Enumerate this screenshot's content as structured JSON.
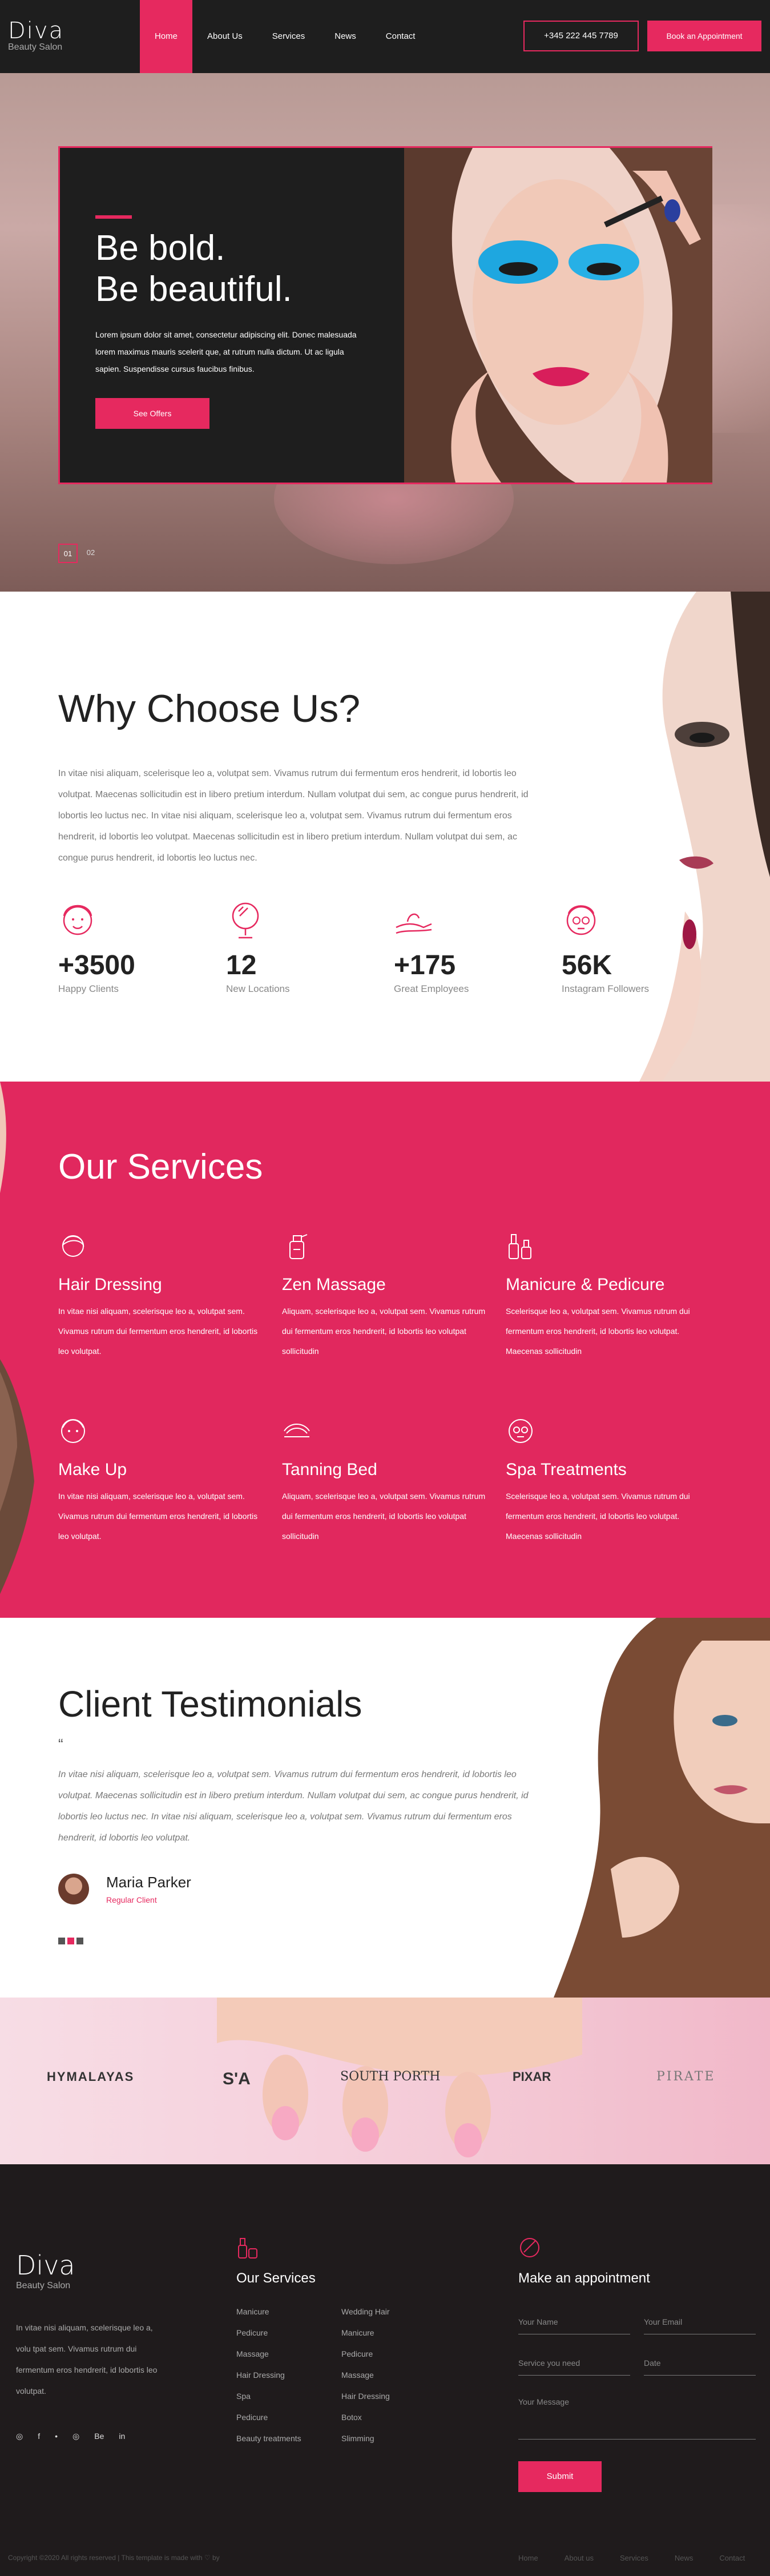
{
  "colors": {
    "accent": "#e6295f",
    "dark": "#1e1e1e"
  },
  "header": {
    "logo_name": "Diva",
    "logo_sub": "Beauty Salon",
    "nav": [
      "Home",
      "About Us",
      "Services",
      "News",
      "Contact"
    ],
    "phone": "+345 222 445 7789",
    "appointment": "Book an Appointment"
  },
  "hero": {
    "title_line1": "Be bold.",
    "title_line2": "Be beautiful.",
    "text": "Lorem ipsum dolor sit amet, consectetur adipiscing elit. Donec malesuada lorem maximus mauris scelerit que, at rutrum nulla dictum. Ut ac ligula sapien. Suspendisse cursus faucibus finibus.",
    "button": "See Offers",
    "pager": [
      "01",
      "02"
    ]
  },
  "why": {
    "title": "Why Choose Us?",
    "text": "In vitae nisi aliquam, scelerisque leo a, volutpat sem. Vivamus rutrum dui fermentum eros hendrerit, id lobortis leo volutpat. Maecenas sollicitudin est in libero pretium interdum. Nullam volutpat dui sem, ac congue purus hendrerit, id lobortis leo luctus nec. In vitae nisi aliquam, scelerisque leo a, volutpat sem. Vivamus rutrum dui fermentum eros hendrerit, id lobortis leo volutpat. Maecenas sollicitudin est in libero pretium interdum. Nullam volutpat dui sem, ac congue purus hendrerit, id lobortis leo luctus nec.",
    "stats": [
      {
        "num": "+3500",
        "label": "Happy Clients",
        "icon": "face-icon"
      },
      {
        "num": "12",
        "label": "New Locations",
        "icon": "mirror-icon"
      },
      {
        "num": "+175",
        "label": "Great Employees",
        "icon": "cream-hand-icon"
      },
      {
        "num": "56K",
        "label": "Instagram Followers",
        "icon": "face-mask-icon"
      }
    ]
  },
  "services": {
    "title": "Our Services",
    "items": [
      {
        "title": "Hair Dressing",
        "text": "In vitae nisi aliquam, scelerisque leo a, volutpat sem. Vivamus rutrum dui fermentum eros hendrerit, id lobortis leo volutpat.",
        "icon": "hair-icon"
      },
      {
        "title": "Zen Massage",
        "text": "Aliquam, scelerisque leo a, volutpat sem. Vivamus rutrum dui fermentum eros hendrerit, id lobortis leo volutpat sollicitudin",
        "icon": "spray-bottle-icon"
      },
      {
        "title": "Manicure & Pedicure",
        "text": "Scelerisque leo a, volutpat sem. Vivamus rutrum dui fermentum eros hendrerit, id lobortis leo volutpat. Maecenas sollicitudin",
        "icon": "nail-polish-icon"
      },
      {
        "title": "Make Up",
        "text": "In vitae nisi aliquam, scelerisque leo a, volutpat sem. Vivamus rutrum dui fermentum eros hendrerit, id lobortis leo volutpat.",
        "icon": "makeup-face-icon"
      },
      {
        "title": "Tanning Bed",
        "text": "Aliquam, scelerisque leo a, volutpat sem. Vivamus rutrum dui fermentum eros hendrerit, id lobortis leo volutpat sollicitudin",
        "icon": "tanning-bed-icon"
      },
      {
        "title": "Spa Treatments",
        "text": "Scelerisque leo a, volutpat sem. Vivamus rutrum dui fermentum eros hendrerit, id lobortis leo volutpat. Maecenas sollicitudin",
        "icon": "spa-mask-icon"
      }
    ]
  },
  "testimonials": {
    "title": "Client Testimonials",
    "quote_mark": "“",
    "text": "In vitae nisi aliquam, scelerisque leo a, volutpat sem. Vivamus rutrum dui fermentum eros hendrerit, id lobortis leo volutpat. Maecenas sollicitudin est in libero pretium interdum. Nullam volutpat dui sem, ac congue purus hendrerit, id lobortis leo luctus nec. In vitae nisi aliquam, scelerisque leo a, volutpat sem. Vivamus rutrum dui fermentum eros hendrerit, id lobortis leo volutpat.",
    "name": "Maria Parker",
    "role": "Regular Client"
  },
  "brands": [
    "HYMALAYAS",
    "S'A",
    "SOUTH PORTH",
    "PIXAR",
    "PIRATE"
  ],
  "footer": {
    "logo_name": "Diva",
    "logo_sub": "Beauty Salon",
    "text": "In vitae nisi aliquam, scelerisque leo a, volu tpat sem. Vivamus rutrum dui fermentum eros hendrerit, id lobortis leo volutpat.",
    "socials": [
      "◎",
      "f",
      "•",
      "◎",
      "Be",
      "in"
    ],
    "services_title": "Our Services",
    "services_col1": [
      "Manicure",
      "Pedicure",
      "Massage",
      "Hair Dressing",
      "Spa",
      "Pedicure",
      "Beauty treatments"
    ],
    "services_col2": [
      "Wedding Hair",
      "Manicure",
      "Pedicure",
      "Massage",
      "Hair Dressing",
      "Botox",
      "Slimming"
    ],
    "appointment_title": "Make an appointment",
    "fields": {
      "name": "Your Name",
      "email": "Your Email",
      "service": "Service you need",
      "date": "Date",
      "message": "Your Message"
    },
    "submit": "Submit",
    "copyright": "Copyright ©2020 All rights reserved | This template is made with ♡ by",
    "links": [
      "Home",
      "About us",
      "Services",
      "News",
      "Contact"
    ]
  }
}
